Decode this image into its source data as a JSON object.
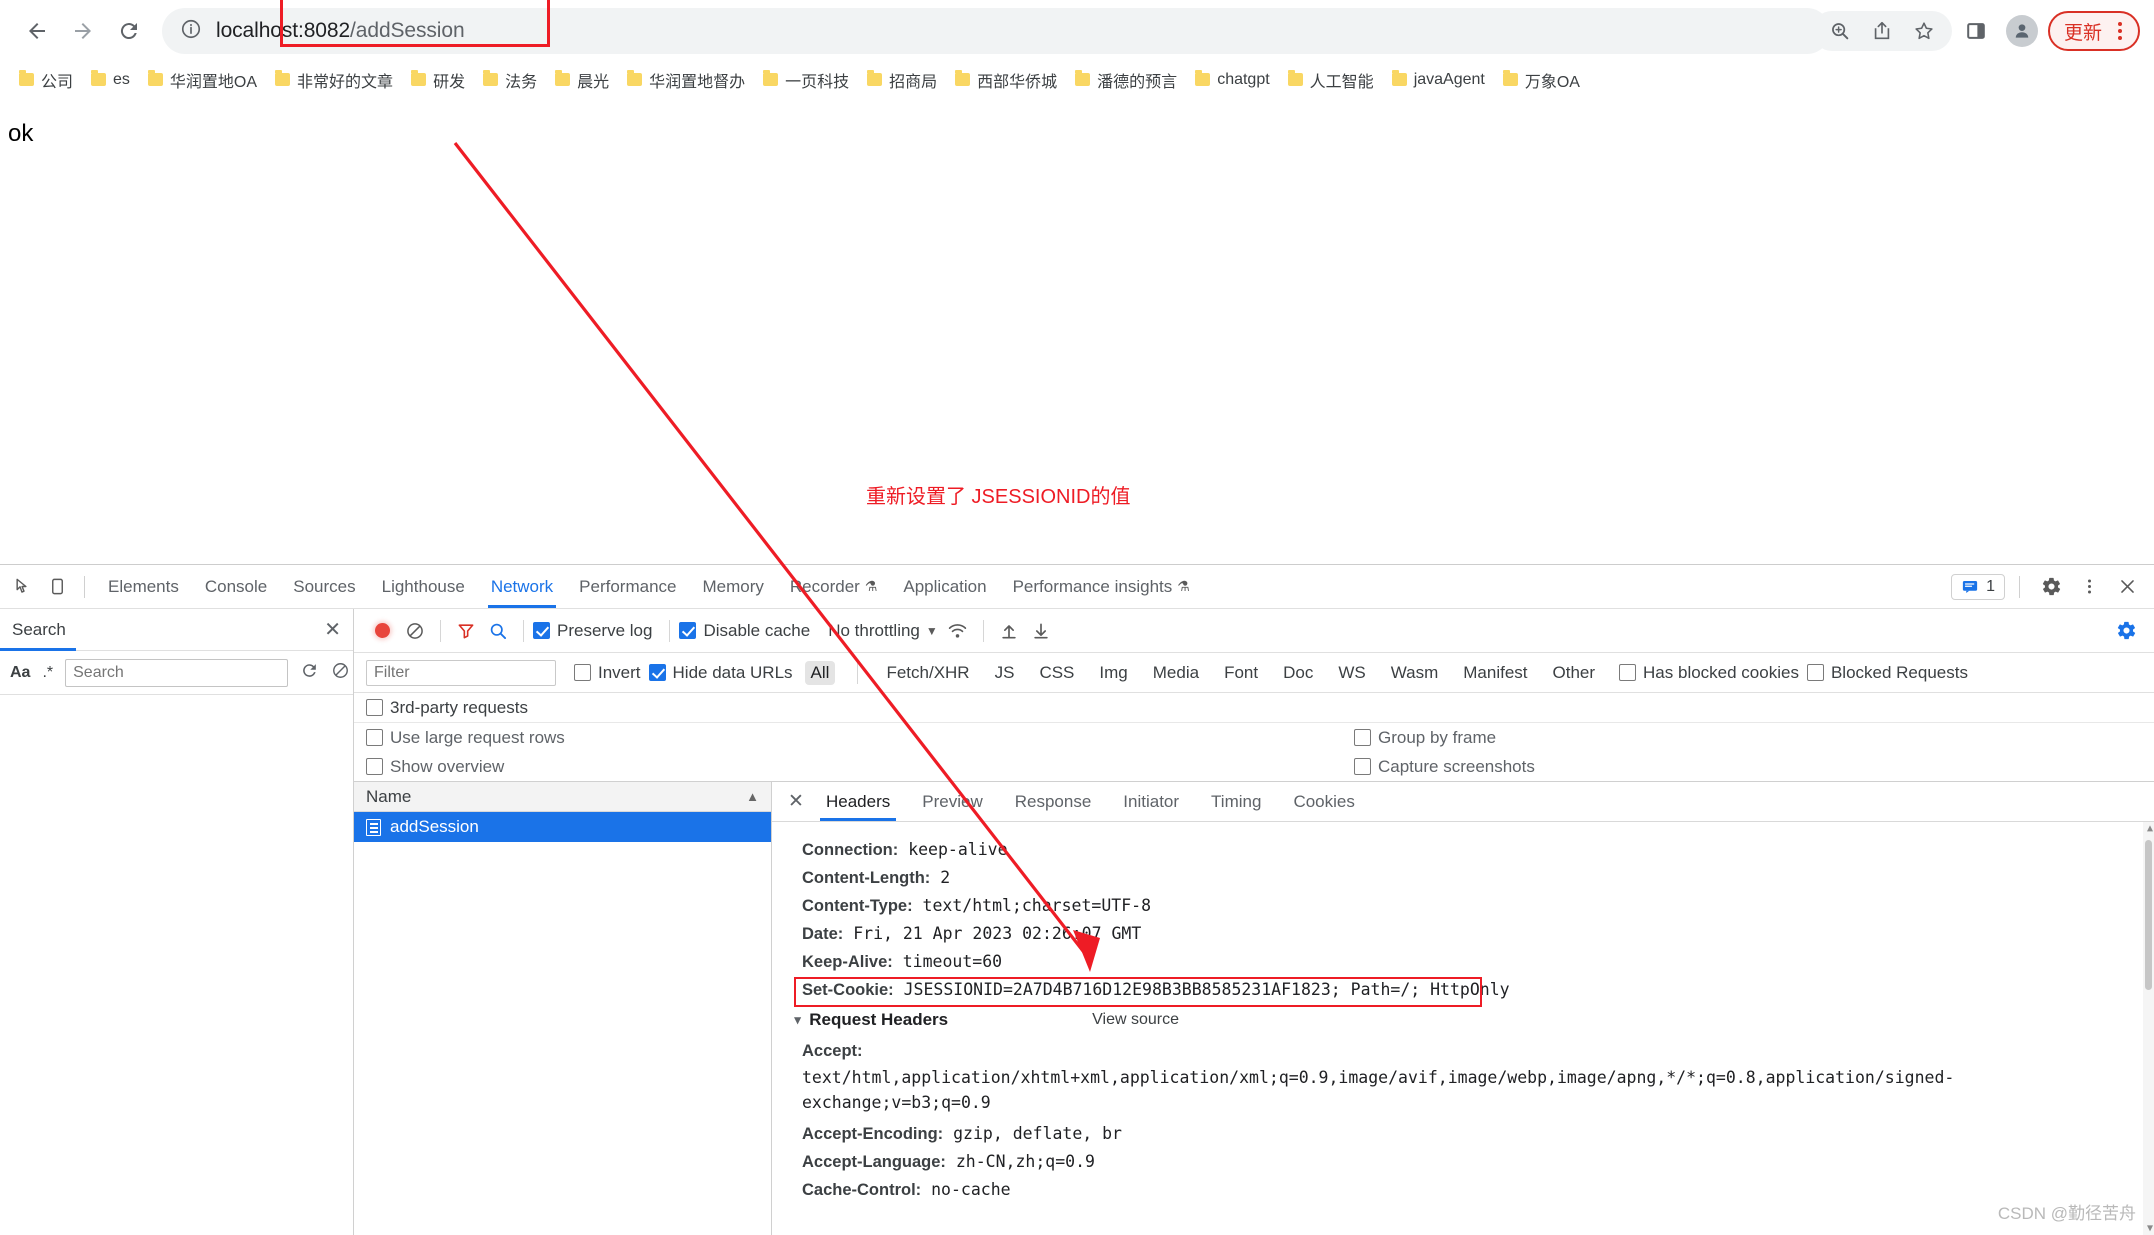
{
  "browser": {
    "nav": {
      "back": "back-arrow",
      "forward": "forward-arrow",
      "reload": "reload"
    },
    "omnibox": {
      "info_icon": "site-info-icon",
      "host": "localhost:8082",
      "path": "/addSession"
    },
    "actions": {
      "zoom_icon": "zoom-in-icon",
      "share_icon": "share-icon",
      "bookmark_icon": "star-icon",
      "sidepanel_icon": "side-panel-icon",
      "profile_icon": "profile-avatar",
      "update_label": "更新"
    }
  },
  "bookmarks": [
    {
      "label": "公司"
    },
    {
      "label": "es"
    },
    {
      "label": "华润置地OA"
    },
    {
      "label": "非常好的文章"
    },
    {
      "label": "研发"
    },
    {
      "label": "法务"
    },
    {
      "label": "晨光"
    },
    {
      "label": "华润置地督办"
    },
    {
      "label": "一页科技"
    },
    {
      "label": "招商局"
    },
    {
      "label": "西部华侨城"
    },
    {
      "label": "潘德的预言"
    },
    {
      "label": "chatgpt"
    },
    {
      "label": "人工智能"
    },
    {
      "label": "javaAgent"
    },
    {
      "label": "万象OA"
    }
  ],
  "page": {
    "body_text": "ok",
    "annotation": "重新设置了 JSESSIONID的值"
  },
  "devtools": {
    "tabs": [
      {
        "label": "Elements",
        "active": false
      },
      {
        "label": "Console",
        "active": false
      },
      {
        "label": "Sources",
        "active": false
      },
      {
        "label": "Lighthouse",
        "active": false
      },
      {
        "label": "Network",
        "active": true
      },
      {
        "label": "Performance",
        "active": false
      },
      {
        "label": "Memory",
        "active": false
      },
      {
        "label": "Recorder",
        "active": false,
        "flask": true
      },
      {
        "label": "Application",
        "active": false
      },
      {
        "label": "Performance insights",
        "active": false,
        "flask": true
      }
    ],
    "message_count": "1",
    "search_panel": {
      "title": "Search",
      "match_case": "Aa",
      "regex": ".*",
      "input_placeholder": "Search",
      "refresh_icon": "refresh-icon",
      "clear_icon": "clear-icon",
      "close_icon": "close-icon"
    },
    "network_toolbar": {
      "record_icon": "record-button",
      "clear_icon": "clear-button",
      "filter_icon": "filter-icon",
      "search_icon": "search-icon",
      "preserve_log": {
        "label": "Preserve log",
        "checked": true
      },
      "disable_cache": {
        "label": "Disable cache",
        "checked": true
      },
      "throttling": "No throttling",
      "wifi_icon": "network-conditions-icon",
      "import_icon": "import-har-icon",
      "export_icon": "export-har-icon"
    },
    "filter_bar": {
      "filter_placeholder": "Filter",
      "invert": {
        "label": "Invert",
        "checked": false
      },
      "hide_data_urls": {
        "label": "Hide data URLs",
        "checked": true
      },
      "types": [
        "All",
        "Fetch/XHR",
        "JS",
        "CSS",
        "Img",
        "Media",
        "Font",
        "Doc",
        "WS",
        "Wasm",
        "Manifest",
        "Other"
      ],
      "selected_type": "All",
      "has_blocked_cookies": {
        "label": "Has blocked cookies",
        "checked": false
      },
      "blocked_requests": {
        "label": "Blocked Requests",
        "checked": false
      },
      "third_party": {
        "label": "3rd-party requests",
        "checked": false
      }
    },
    "options": {
      "use_large_request_rows": {
        "label": "Use large request rows",
        "checked": false
      },
      "show_overview": {
        "label": "Show overview",
        "checked": false
      },
      "group_by_frame": {
        "label": "Group by frame",
        "checked": false
      },
      "capture_screenshots": {
        "label": "Capture screenshots",
        "checked": false
      }
    },
    "request_table": {
      "column_name": "Name",
      "sort_indicator": "▲",
      "rows": [
        {
          "name": "addSession",
          "selected": true
        }
      ]
    },
    "detail": {
      "tabs": [
        {
          "label": "Headers",
          "active": true
        },
        {
          "label": "Preview",
          "active": false
        },
        {
          "label": "Response",
          "active": false
        },
        {
          "label": "Initiator",
          "active": false
        },
        {
          "label": "Timing",
          "active": false
        },
        {
          "label": "Cookies",
          "active": false
        }
      ],
      "close_icon": "close-icon",
      "response_headers": [
        {
          "name": "Connection:",
          "value": "keep-alive"
        },
        {
          "name": "Content-Length:",
          "value": "2"
        },
        {
          "name": "Content-Type:",
          "value": "text/html;charset=UTF-8"
        },
        {
          "name": "Date:",
          "value": "Fri, 21 Apr 2023 02:26:07 GMT"
        },
        {
          "name": "Keep-Alive:",
          "value": "timeout=60"
        },
        {
          "name": "Set-Cookie:",
          "value": "JSESSIONID=2A7D4B716D12E98B3BB8585231AF1823; Path=/; HttpOnly",
          "highlighted": true
        }
      ],
      "request_headers_section": {
        "title": "Request Headers",
        "view_source": "View source",
        "items": [
          {
            "name": "Accept:",
            "value": "text/html,application/xhtml+xml,application/xml;q=0.9,image/avif,image/webp,image/apng,*/*;q=0.8,application/signed-exchange;v=b3;q=0.9"
          },
          {
            "name": "Accept-Encoding:",
            "value": "gzip, deflate, br"
          },
          {
            "name": "Accept-Language:",
            "value": "zh-CN,zh;q=0.9"
          },
          {
            "name": "Cache-Control:",
            "value": "no-cache"
          }
        ]
      }
    }
  },
  "watermark": "CSDN @勤径苦舟",
  "colors": {
    "accent_blue": "#1a73e8",
    "annotation_red": "#ee1c25",
    "selected_row": "#1a73e8",
    "folder_yellow": "#f9d763"
  }
}
